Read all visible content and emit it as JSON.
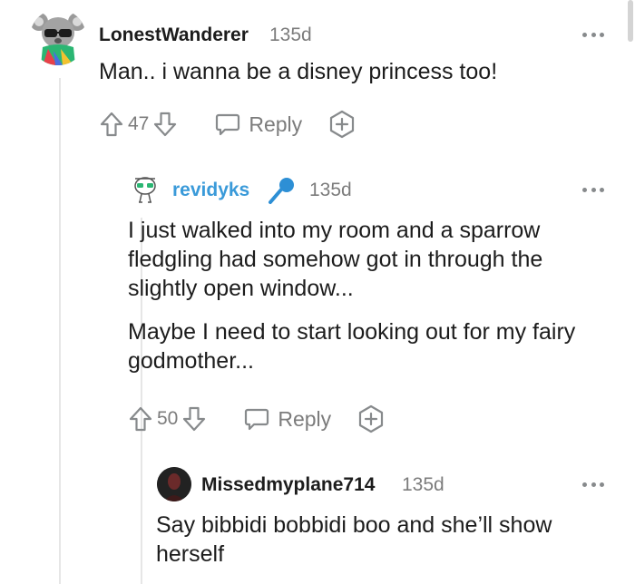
{
  "comments": [
    {
      "username": "LonestWanderer",
      "age": "135d",
      "body": [
        "Man.. i wanna be a disney princess too!"
      ],
      "score": "47",
      "reply_label": "Reply"
    },
    {
      "username": "revidyks",
      "age": "135d",
      "body": [
        "I just walked into my room and a sparrow fledgling had somehow got in through the slightly open window...",
        "Maybe I need to start looking out for my fairy godmother..."
      ],
      "score": "50",
      "reply_label": "Reply"
    },
    {
      "username": "Missedmyplane714",
      "age": "135d",
      "body": [
        "Say bibbidi bobbidi boo and she’ll show herself"
      ]
    }
  ],
  "colors": {
    "link_username": "#3a9ad9",
    "mic_badge": "#2d8fd5",
    "muted": "#7c7c7c",
    "thread_line": "#e6e6e6"
  },
  "icons": {
    "more": "more-options-icon",
    "upvote": "upvote-arrow-icon",
    "downvote": "downvote-arrow-icon",
    "reply": "speech-bubble-icon",
    "award": "award-plus-icon",
    "mic": "microphone-badge-icon"
  }
}
